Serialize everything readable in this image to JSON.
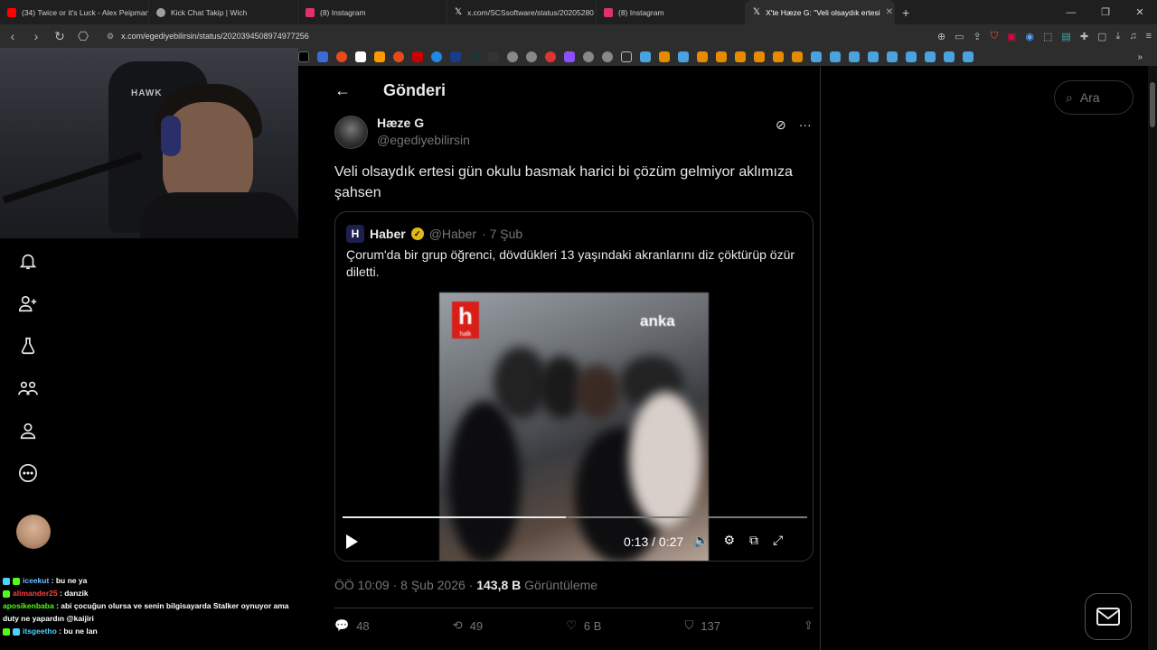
{
  "browser": {
    "tabs": [
      {
        "label": "(34) Twice or it's Luck - Alex Peipman",
        "favicon_color": "#ff0000",
        "active": false
      },
      {
        "label": "Kick Chat Takip | Wich",
        "favicon_color": "#9aa0a6",
        "active": false
      },
      {
        "label": "(8) Instagram",
        "favicon_color": "#e1306c",
        "active": false
      },
      {
        "label": "x.com/SCSsoftware/status/20205280",
        "favicon_color": "#ffffff",
        "active": false
      },
      {
        "label": "(8) Instagram",
        "favicon_color": "#e1306c",
        "active": false
      },
      {
        "label": "X'te Hæze G: \"Veli olsaydık ertesi",
        "favicon_color": "#ffffff",
        "active": true
      }
    ],
    "new_tab": "+",
    "url": "x.com/egediyebilirsin/status/2020394508974977256"
  },
  "chat": [
    {
      "user": "iceekut",
      "message": ": bu ne ya",
      "color": "#6ac3ff"
    },
    {
      "user": "alimander25",
      "message": ": danzik",
      "color": "#ff4040"
    },
    {
      "user": "aposikenbaba",
      "message": ": abi çocuğun olursa ve senin bilgisayarda Stalker oynuyor ama duty ne yapardın @kaijiri",
      "color": "#53fc18"
    },
    {
      "user": "itsgeetho",
      "message": ": bu ne lan",
      "color": "#4dd2ff"
    }
  ],
  "webcam": {
    "chair_logo": "HAWK"
  },
  "post": {
    "header_title": "Gönderi",
    "author_name": "Hæze G",
    "author_handle": "@egediyebilirsin",
    "text": "Veli olsaydık ertesi gün okulu basmak harici bi çözüm gelmiyor aklımıza şahsen",
    "meta_time": "ÖÖ 10:09 · 8 Şub 2026 · ",
    "meta_views": "143,8 B",
    "meta_views_label": " Görüntüleme",
    "replies": "48",
    "reposts": "49",
    "likes": "6 B",
    "bookmarks": "137"
  },
  "quote": {
    "logo_letter": "H",
    "name": "Haber",
    "handle": "@Haber",
    "date": "· 7 Şub",
    "text": "Çorum'da bir grup öğrenci, dövdükleri 13 yaşındaki akranlarını diz çöktürüp özür diletti.",
    "video": {
      "channel_logo": "h",
      "channel_sub": "halk",
      "watermark": "anka",
      "time": "0:13 / 0:27",
      "progress": 0.48
    }
  },
  "search": {
    "placeholder": "Ara"
  }
}
